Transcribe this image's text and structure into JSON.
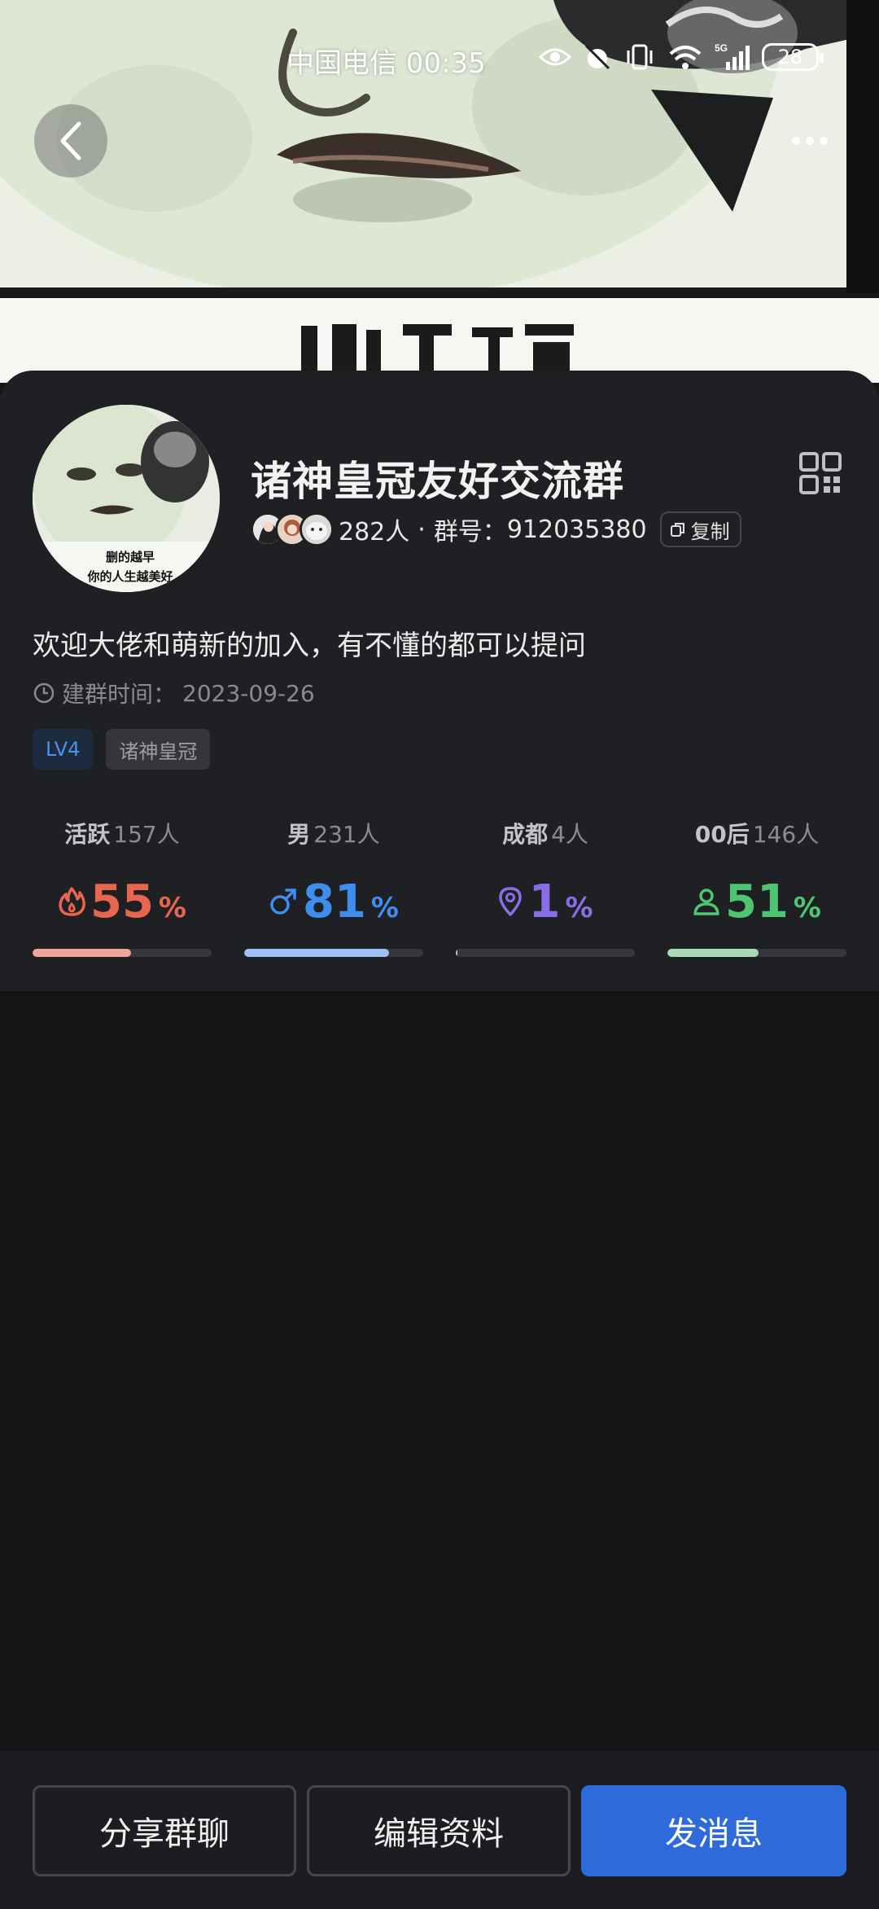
{
  "status_bar": {
    "carrier_time": "中国电信 00:35",
    "network": "5G",
    "battery": "28"
  },
  "hero": {
    "caption_partial": "删的越早"
  },
  "group": {
    "name": "诸神皇冠友好交流群",
    "member_count": "282人",
    "separator": "·",
    "id_label": "群号：",
    "id": "912035380",
    "copy_label": "复制",
    "avatar_caption_line1": "删的越早",
    "avatar_caption_line2": "你的人生越美好",
    "description": "欢迎大佬和萌新的加入，有不懂的都可以提问",
    "created_label": "建群时间：",
    "created_date": "2023-09-26",
    "tags": [
      "LV4",
      "诸神皇冠"
    ]
  },
  "stats": [
    {
      "label": "活跃",
      "sub": "157人",
      "value": "55",
      "unit": "%",
      "percent": 55,
      "color": "#e8654f",
      "bar_color": "#f0a396",
      "icon": "flame-icon"
    },
    {
      "label": "男",
      "sub": "231人",
      "value": "81",
      "unit": "%",
      "percent": 81,
      "color": "#3d8ef0",
      "bar_color": "#9ec2f3",
      "icon": "male-icon"
    },
    {
      "label": "成都",
      "sub": "4人",
      "value": "1",
      "unit": "%",
      "percent": 1,
      "color": "#8a6de8",
      "bar_color": "#c2c3c7",
      "icon": "location-pin-icon"
    },
    {
      "label": "00后",
      "sub": "146人",
      "value": "51",
      "unit": "%",
      "percent": 51,
      "color": "#4fc472",
      "bar_color": "#a6dbb6",
      "icon": "person-icon"
    }
  ],
  "actions": {
    "share": "分享群聊",
    "edit": "编辑资料",
    "send": "发消息"
  }
}
